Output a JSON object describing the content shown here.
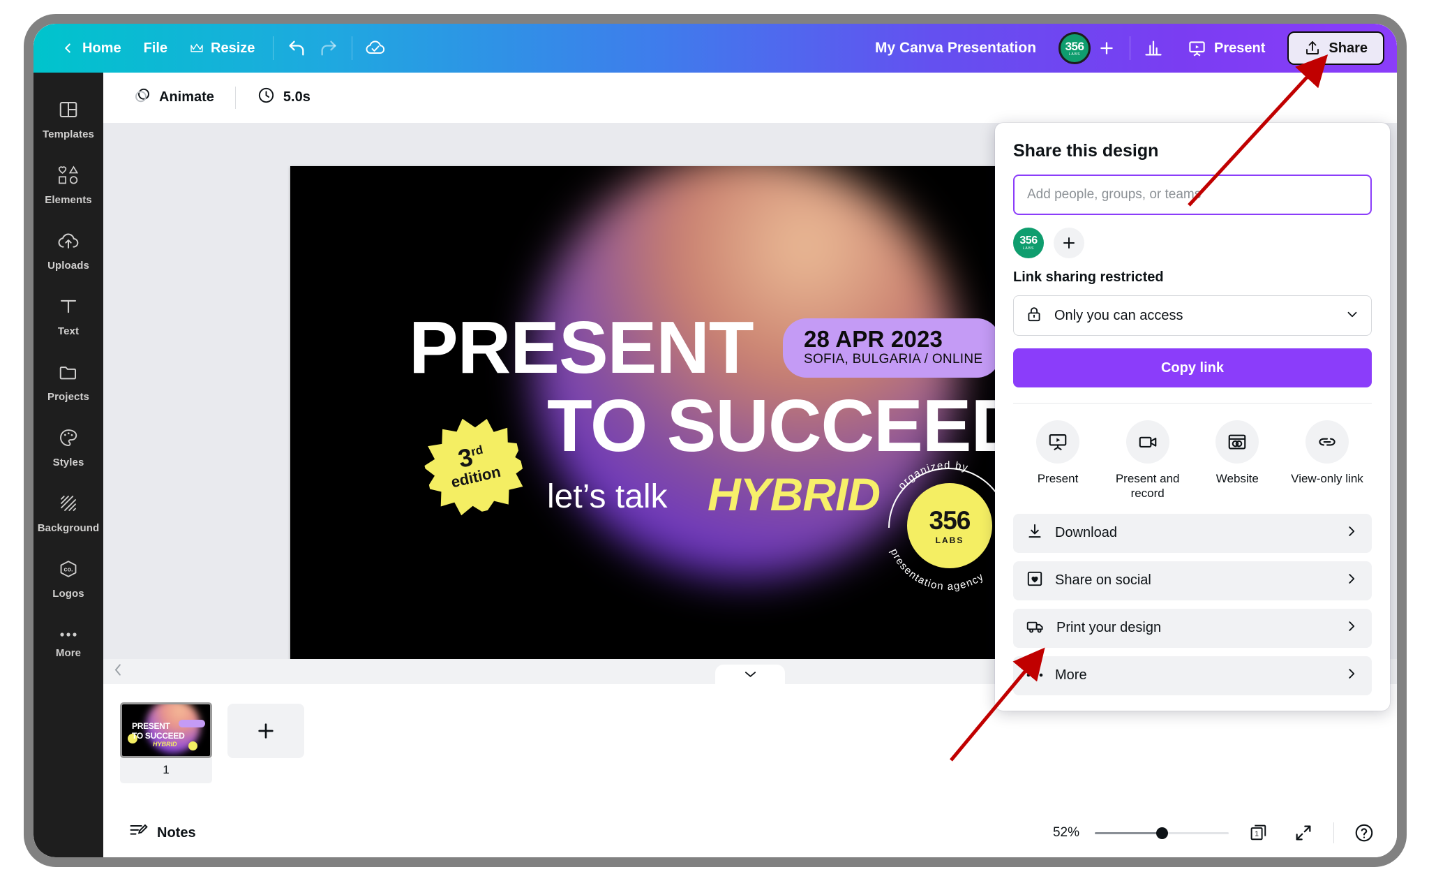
{
  "topbar": {
    "back_label": "Home",
    "file_label": "File",
    "resize_label": "Resize",
    "doc_title": "My Canva Presentation",
    "avatar_main": "356",
    "avatar_sub": "LABS",
    "present_label": "Present",
    "share_label": "Share",
    "gradient_start": "#00c4cc",
    "gradient_end": "#8b3dfa"
  },
  "sidebar": {
    "items": [
      {
        "label": "Templates",
        "icon": "templates-icon"
      },
      {
        "label": "Elements",
        "icon": "elements-icon"
      },
      {
        "label": "Uploads",
        "icon": "uploads-icon"
      },
      {
        "label": "Text",
        "icon": "text-icon"
      },
      {
        "label": "Projects",
        "icon": "projects-icon"
      },
      {
        "label": "Styles",
        "icon": "styles-icon"
      },
      {
        "label": "Background",
        "icon": "background-icon"
      },
      {
        "label": "Logos",
        "icon": "logos-icon"
      },
      {
        "label": "More",
        "icon": "more-icon"
      }
    ]
  },
  "anim_bar": {
    "animate_label": "Animate",
    "duration_label": "5.0s"
  },
  "slide": {
    "title_line1": "PRESENT",
    "title_line2": "TO SUCCEED",
    "subtitle": "let’s talk",
    "highlight": "HYBRID",
    "badge_number": "3",
    "badge_ordinal": "rd",
    "badge_word": "edition",
    "date": "28 APR 2023",
    "location": "SOFIA, BULGARIA / ONLINE",
    "seal_arc_top": "organized by",
    "seal_arc_bottom": "presentation agency",
    "seal_logo_main": "356",
    "seal_logo_sub": "LABS",
    "bg_color": "#000000",
    "accent_yellow": "#f4ee63",
    "accent_lilac": "#c49bf5"
  },
  "pages": {
    "page_number": "1",
    "add_page_icon": "plus-icon",
    "thumb_line1": "PRESENT",
    "thumb_line2": "TO SUCCEED",
    "thumb_line3": "HYBRID"
  },
  "bottombar": {
    "notes_label": "Notes",
    "zoom_percent": "52%",
    "page_count": "1",
    "fullscreen_icon": "expand-icon",
    "help_icon": "help-icon"
  },
  "share_panel": {
    "title": "Share this design",
    "input_placeholder": "Add people, groups, or teams",
    "avatar_main": "356",
    "avatar_sub": "LABS",
    "add_person_icon": "plus-icon",
    "link_status": "Link sharing restricted",
    "access_value": "Only you can access",
    "copy_link_label": "Copy link",
    "accent_color": "#8b3dfa",
    "quick_actions": [
      {
        "label": "Present",
        "icon": "present-icon"
      },
      {
        "label": "Present and record",
        "icon": "video-icon"
      },
      {
        "label": "Website",
        "icon": "website-icon"
      },
      {
        "label": "View-only link",
        "icon": "link-icon"
      }
    ],
    "rows": [
      {
        "label": "Download",
        "icon": "download-icon"
      },
      {
        "label": "Share on social",
        "icon": "social-icon"
      },
      {
        "label": "Print your design",
        "icon": "truck-icon"
      },
      {
        "label": "More",
        "icon": "ellipsis-icon"
      }
    ]
  },
  "annotations": {
    "arrow_color": "#c00000",
    "arrow_count": "2"
  }
}
